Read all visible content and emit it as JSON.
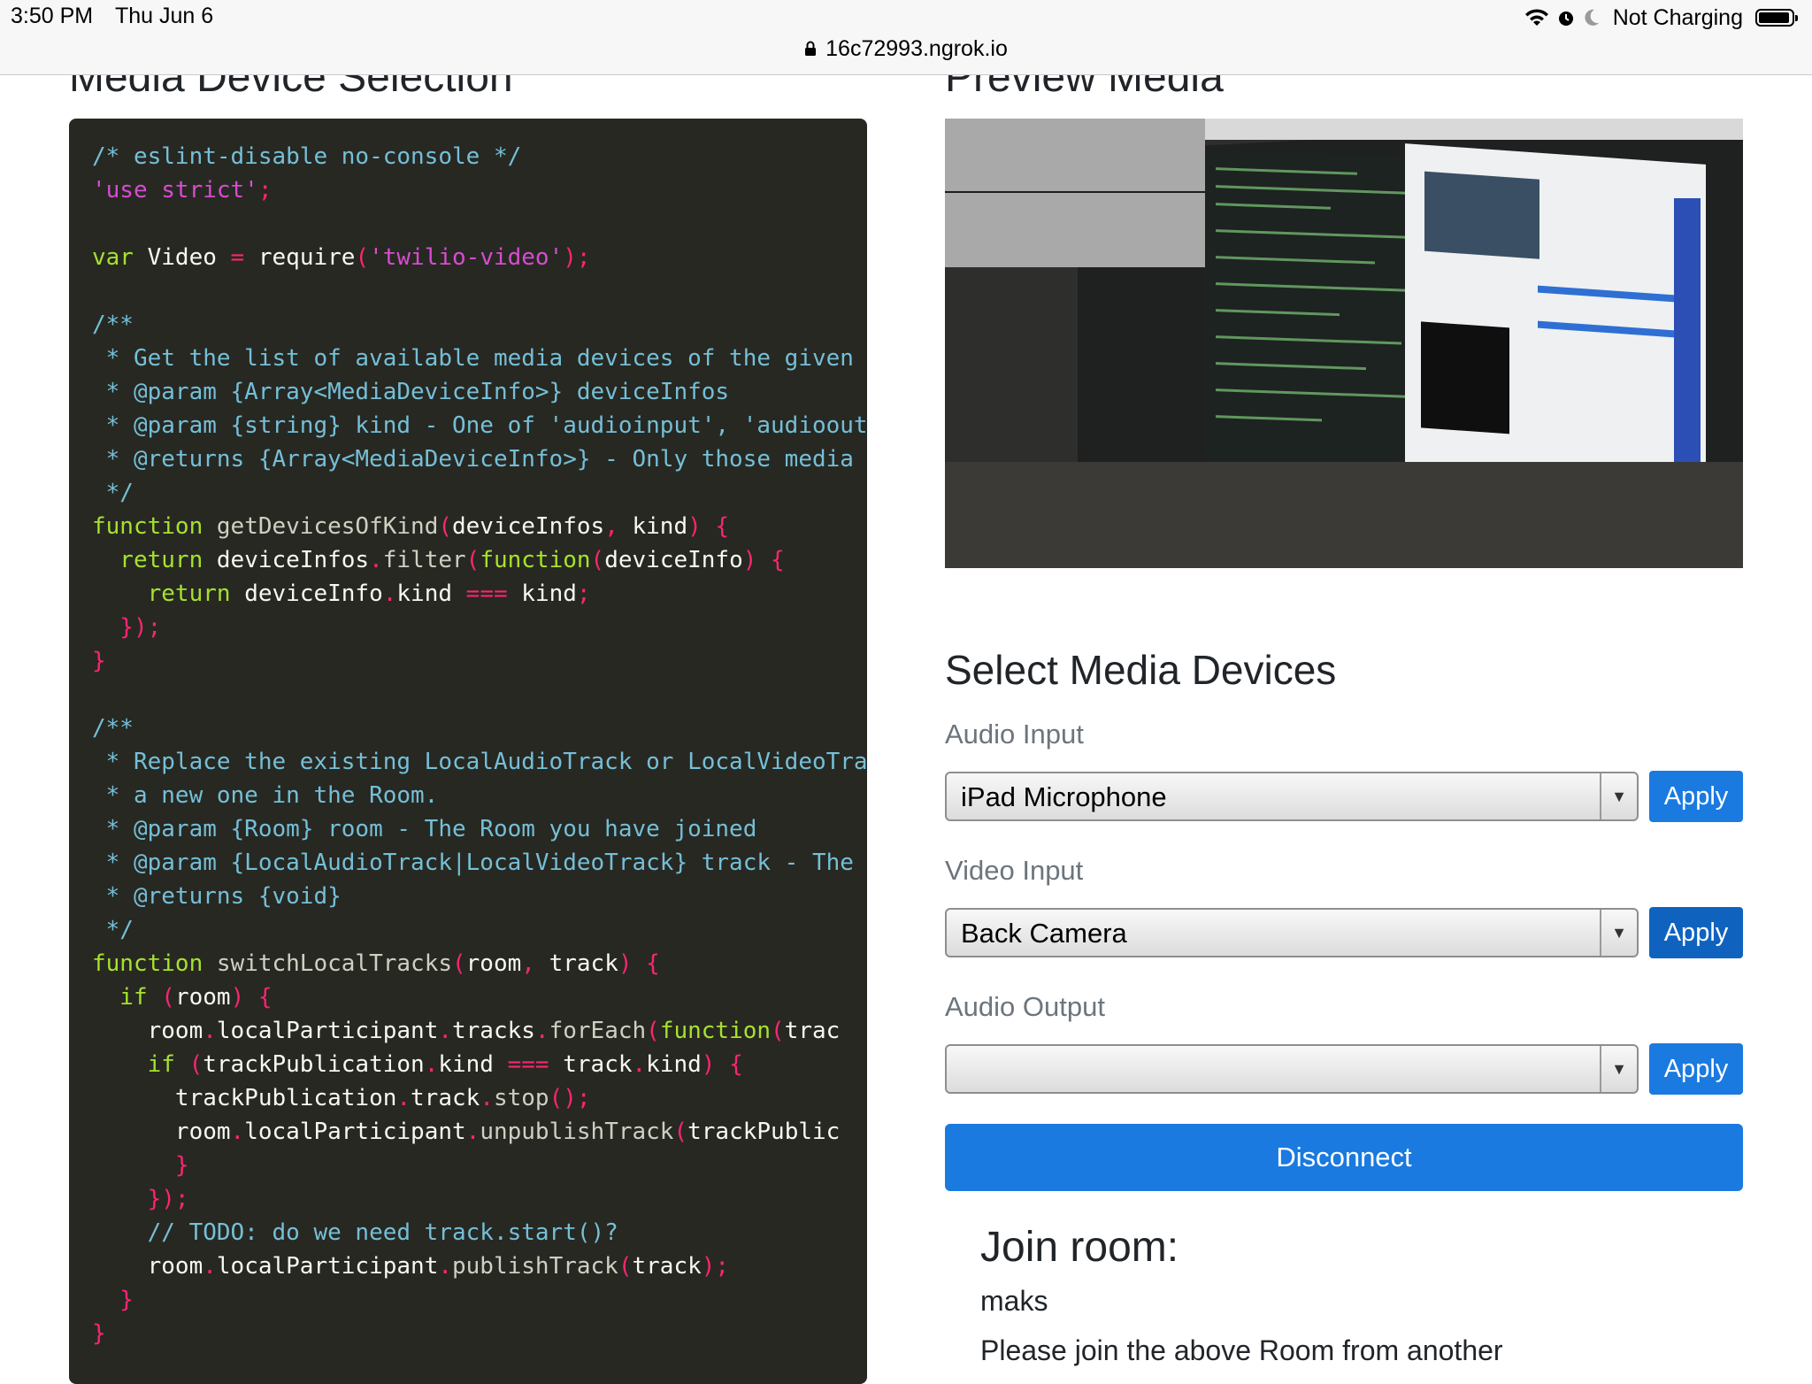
{
  "status_bar": {
    "time": "3:50 PM",
    "date": "Thu Jun 6",
    "battery_text": "Not Charging",
    "battery_level": 0.95,
    "icons": [
      "wifi-icon",
      "alarm-icon",
      "moon-icon",
      "battery-icon"
    ]
  },
  "browser": {
    "url": "16c72993.ngrok.io",
    "lock_icon": "lock-icon"
  },
  "left_heading": "Media Device Selection",
  "right_heading": "Preview Media",
  "code": {
    "lines": [
      [
        [
          "cm",
          "/* eslint-disable no-console */"
        ]
      ],
      [
        [
          "str2",
          "'use strict'"
        ],
        [
          "pn",
          ";"
        ]
      ],
      [],
      [
        [
          "kw",
          "var"
        ],
        [
          "id",
          " Video "
        ],
        [
          "pn",
          "="
        ],
        [
          "id",
          " require"
        ],
        [
          "pn",
          "("
        ],
        [
          "str2",
          "'twilio-video'"
        ],
        [
          "pn",
          ");"
        ]
      ],
      [],
      [
        [
          "cm",
          "/**"
        ]
      ],
      [
        [
          "cm",
          " * Get the list of available media devices of the given"
        ]
      ],
      [
        [
          "cm",
          " * @param {Array<MediaDeviceInfo>} deviceInfos"
        ]
      ],
      [
        [
          "cm",
          " * @param {string} kind - One of 'audioinput', 'audioout"
        ]
      ],
      [
        [
          "cm",
          " * @returns {Array<MediaDeviceInfo>} - Only those media "
        ]
      ],
      [
        [
          "cm",
          " */"
        ]
      ],
      [
        [
          "kw",
          "function"
        ],
        [
          "fn",
          " getDevicesOfKind"
        ],
        [
          "pn",
          "("
        ],
        [
          "id",
          "deviceInfos"
        ],
        [
          "pn",
          ","
        ],
        [
          "id",
          " kind"
        ],
        [
          "pn",
          ") {"
        ]
      ],
      [
        [
          "kw",
          "  return"
        ],
        [
          "id",
          " deviceInfos"
        ],
        [
          "pn",
          "."
        ],
        [
          "fn",
          "filter"
        ],
        [
          "pn",
          "("
        ],
        [
          "kw",
          "function"
        ],
        [
          "pn",
          "("
        ],
        [
          "id",
          "deviceInfo"
        ],
        [
          "pn",
          ") {"
        ]
      ],
      [
        [
          "kw",
          "    return"
        ],
        [
          "id",
          " deviceInfo"
        ],
        [
          "pn",
          "."
        ],
        [
          "id",
          "kind "
        ],
        [
          "pn",
          "==="
        ],
        [
          "id",
          " kind"
        ],
        [
          "pn",
          ";"
        ]
      ],
      [
        [
          "pn",
          "  });"
        ]
      ],
      [
        [
          "pn",
          "}"
        ]
      ],
      [],
      [
        [
          "cm",
          "/**"
        ]
      ],
      [
        [
          "cm",
          " * Replace the existing LocalAudioTrack or LocalVideoTra"
        ]
      ],
      [
        [
          "cm",
          " * a new one in the Room."
        ]
      ],
      [
        [
          "cm",
          " * @param {Room} room - The Room you have joined"
        ]
      ],
      [
        [
          "cm",
          " * @param {LocalAudioTrack|LocalVideoTrack} track - The"
        ]
      ],
      [
        [
          "cm",
          " * @returns {void}"
        ]
      ],
      [
        [
          "cm",
          " */"
        ]
      ],
      [
        [
          "kw",
          "function"
        ],
        [
          "fn",
          " switchLocalTracks"
        ],
        [
          "pn",
          "("
        ],
        [
          "id",
          "room"
        ],
        [
          "pn",
          ","
        ],
        [
          "id",
          " track"
        ],
        [
          "pn",
          ") {"
        ]
      ],
      [
        [
          "kw",
          "  if"
        ],
        [
          "pn",
          " ("
        ],
        [
          "id",
          "room"
        ],
        [
          "pn",
          ") {"
        ]
      ],
      [
        [
          "id",
          "    room"
        ],
        [
          "pn",
          "."
        ],
        [
          "id",
          "localParticipant"
        ],
        [
          "pn",
          "."
        ],
        [
          "id",
          "tracks"
        ],
        [
          "pn",
          "."
        ],
        [
          "fn",
          "forEach"
        ],
        [
          "pn",
          "("
        ],
        [
          "kw",
          "function"
        ],
        [
          "pn",
          "("
        ],
        [
          "id",
          "trac"
        ]
      ],
      [
        [
          "kw",
          "    if"
        ],
        [
          "pn",
          " ("
        ],
        [
          "id",
          "trackPublication"
        ],
        [
          "pn",
          "."
        ],
        [
          "id",
          "kind "
        ],
        [
          "pn",
          "==="
        ],
        [
          "id",
          " track"
        ],
        [
          "pn",
          "."
        ],
        [
          "id",
          "kind"
        ],
        [
          "pn",
          ") {"
        ]
      ],
      [
        [
          "id",
          "      trackPublication"
        ],
        [
          "pn",
          "."
        ],
        [
          "id",
          "track"
        ],
        [
          "pn",
          "."
        ],
        [
          "fn",
          "stop"
        ],
        [
          "pn",
          "();"
        ]
      ],
      [
        [
          "id",
          "      room"
        ],
        [
          "pn",
          "."
        ],
        [
          "id",
          "localParticipant"
        ],
        [
          "pn",
          "."
        ],
        [
          "fn",
          "unpublishTrack"
        ],
        [
          "pn",
          "("
        ],
        [
          "id",
          "trackPublic"
        ]
      ],
      [
        [
          "pn",
          "      }"
        ]
      ],
      [
        [
          "pn",
          "    });"
        ]
      ],
      [
        [
          "cm",
          "    // TODO: do we need track.start()?"
        ]
      ],
      [
        [
          "id",
          "    room"
        ],
        [
          "pn",
          "."
        ],
        [
          "id",
          "localParticipant"
        ],
        [
          "pn",
          "."
        ],
        [
          "fn",
          "publishTrack"
        ],
        [
          "pn",
          "("
        ],
        [
          "id",
          "track"
        ],
        [
          "pn",
          ");"
        ]
      ],
      [
        [
          "pn",
          "  }"
        ]
      ],
      [
        [
          "pn",
          "}"
        ]
      ]
    ]
  },
  "select_devices": {
    "title": "Select Media Devices",
    "fields": [
      {
        "label": "Audio Input",
        "value": "iPad Microphone",
        "button": "Apply"
      },
      {
        "label": "Video Input",
        "value": "Back Camera",
        "button": "Apply"
      },
      {
        "label": "Audio Output",
        "value": "",
        "button": "Apply"
      }
    ],
    "disconnect": "Disconnect"
  },
  "join": {
    "title": "Join room:",
    "room": "maks",
    "hint": "Please join the above Room from another"
  },
  "colors": {
    "accent": "#1a7ae0",
    "code_bg": "#272822"
  }
}
